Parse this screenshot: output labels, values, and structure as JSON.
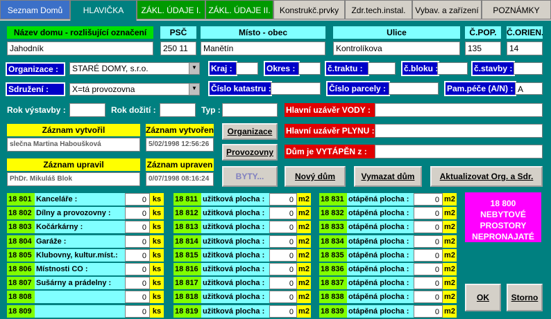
{
  "tabs": [
    {
      "label": "Seznam Domů"
    },
    {
      "label": "HLAVIČKA"
    },
    {
      "label": "ZÁKL. ÚDAJE I."
    },
    {
      "label": "ZÁKL. ÚDAJE II."
    },
    {
      "label": "Konstrukč.prvky"
    },
    {
      "label": "Zdr.tech.instal."
    },
    {
      "label": "Vybav. a zařízení"
    },
    {
      "label": "POZNÁMKY"
    }
  ],
  "header": {
    "nazev_label": "Název domu - rozlišující označení",
    "nazev_value": "Jahodník",
    "psc_label": "PSČ",
    "psc_value": "250 11",
    "misto_label": "Místo - obec",
    "misto_value": "Manětín",
    "ulice_label": "Ulice",
    "ulice_value": "Kontrolíkova",
    "cpop_label": "Č.POP.",
    "cpop_value": "135",
    "corien_label": "Č.ORIEN.",
    "corien_value": "14"
  },
  "org": {
    "organizace_label": "Organizace :",
    "organizace_value": "STARÉ DOMY, s.r.o.",
    "sdruzeni_label": "Sdružení :",
    "sdruzeni_value": "X=tá provozovna",
    "kraj_label": "Kraj :",
    "okres_label": "Okres :",
    "ctraktu_label": "č.traktu :",
    "cbloku_label": "č.bloku :",
    "cstavby_label": "č.stavby :",
    "cislo_katastru_label": "Číslo katastru :",
    "cislo_parcely_label": "Číslo parcely :",
    "pam_pece_label": "Pam.péče (A/N) :",
    "pam_pece_value": "A",
    "rok_vystavby_label": "Rok výstavby :",
    "rok_doziti_label": "Rok dožití :",
    "typ_label": "Typ :",
    "uzaver_vody_label": "Hlavní uzávěr VODY :",
    "uzaver_plynu_label": "Hlavní uzávěr PLYNU :",
    "vytapen_label": "Dům je VYTÁPĚN z :"
  },
  "records": {
    "vytvoril_label": "Záznam vytvořil",
    "vytvoril_value": "slečna Martina Habouškov​á",
    "vytvoren_label": "Záznam vytvořen",
    "vytvoren_value": "5/02/1998 12:56:26",
    "upravil_label": "Záznam upravil",
    "upravil_value": "PhDr. Mikuláš Blok",
    "upraven_label": "Záznam upraven",
    "upraven_value": "0/07/1998 08:16:24"
  },
  "buttons": {
    "organizace": "Organizace",
    "provozovny": "Provozovny",
    "byty": "BYTY...",
    "novy_dum": "Nový dům",
    "vymazat_dum": "Vymazat dům",
    "aktualizovat": "Aktualizovat Org. a Sdr.",
    "ok": "OK",
    "storno": "Storno"
  },
  "col1": [
    {
      "code": "18 801",
      "label": "Kanceláře :",
      "value": "0",
      "unit": "ks"
    },
    {
      "code": "18 802",
      "label": "Dílny a provozovny :",
      "value": "0",
      "unit": "ks"
    },
    {
      "code": "18 803",
      "label": "Kočárkárny :",
      "value": "0",
      "unit": "ks"
    },
    {
      "code": "18 804",
      "label": "Garáže :",
      "value": "0",
      "unit": "ks"
    },
    {
      "code": "18 805",
      "label": "Klubovny, kultur.míst.:",
      "value": "0",
      "unit": "ks"
    },
    {
      "code": "18 806",
      "label": "Místnosti CO :",
      "value": "0",
      "unit": "ks"
    },
    {
      "code": "18 807",
      "label": "Sušárny a prádelny :",
      "value": "0",
      "unit": "ks"
    },
    {
      "code": "18 808",
      "label": "",
      "value": "0",
      "unit": "ks"
    },
    {
      "code": "18 809",
      "label": "",
      "value": "0",
      "unit": "ks"
    }
  ],
  "col2": [
    {
      "code": "18 811",
      "label": "užitková plocha :",
      "value": "0",
      "unit": "m2"
    },
    {
      "code": "18 812",
      "label": "užitková plocha :",
      "value": "0",
      "unit": "m2"
    },
    {
      "code": "18 813",
      "label": "užitková plocha :",
      "value": "0",
      "unit": "m2"
    },
    {
      "code": "18 814",
      "label": "užitková plocha :",
      "value": "0",
      "unit": "m2"
    },
    {
      "code": "18 815",
      "label": "užitková plocha :",
      "value": "0",
      "unit": "m2"
    },
    {
      "code": "18 816",
      "label": "užitková plocha :",
      "value": "0",
      "unit": "m2"
    },
    {
      "code": "18 817",
      "label": "užitková plocha :",
      "value": "0",
      "unit": "m2"
    },
    {
      "code": "18 818",
      "label": "užitková plocha :",
      "value": "0",
      "unit": "m2"
    },
    {
      "code": "18 819",
      "label": "užitková plocha :",
      "value": "0",
      "unit": "m2"
    }
  ],
  "col3": [
    {
      "code": "18 831",
      "label": "otápěná plocha :",
      "value": "0",
      "unit": "m2"
    },
    {
      "code": "18 832",
      "label": "otápěná plocha :",
      "value": "0",
      "unit": "m2"
    },
    {
      "code": "18 833",
      "label": "otápěná plocha :",
      "value": "0",
      "unit": "m2"
    },
    {
      "code": "18 834",
      "label": "otápěná plocha :",
      "value": "0",
      "unit": "m2"
    },
    {
      "code": "18 835",
      "label": "otápěná plocha :",
      "value": "0",
      "unit": "m2"
    },
    {
      "code": "18 836",
      "label": "otápěná plocha :",
      "value": "0",
      "unit": "m2"
    },
    {
      "code": "18 837",
      "label": "otápěná plocha :",
      "value": "0",
      "unit": "m2"
    },
    {
      "code": "18 838",
      "label": "otápěná plocha :",
      "value": "0",
      "unit": "m2"
    },
    {
      "code": "18 839",
      "label": "otápěná plocha :",
      "value": "0",
      "unit": "m2"
    }
  ],
  "badge": {
    "line1": "18 800",
    "line2": "NEBYTOVÉ",
    "line3": "PROSTORY",
    "line4": "NEPRONAJATÉ"
  }
}
